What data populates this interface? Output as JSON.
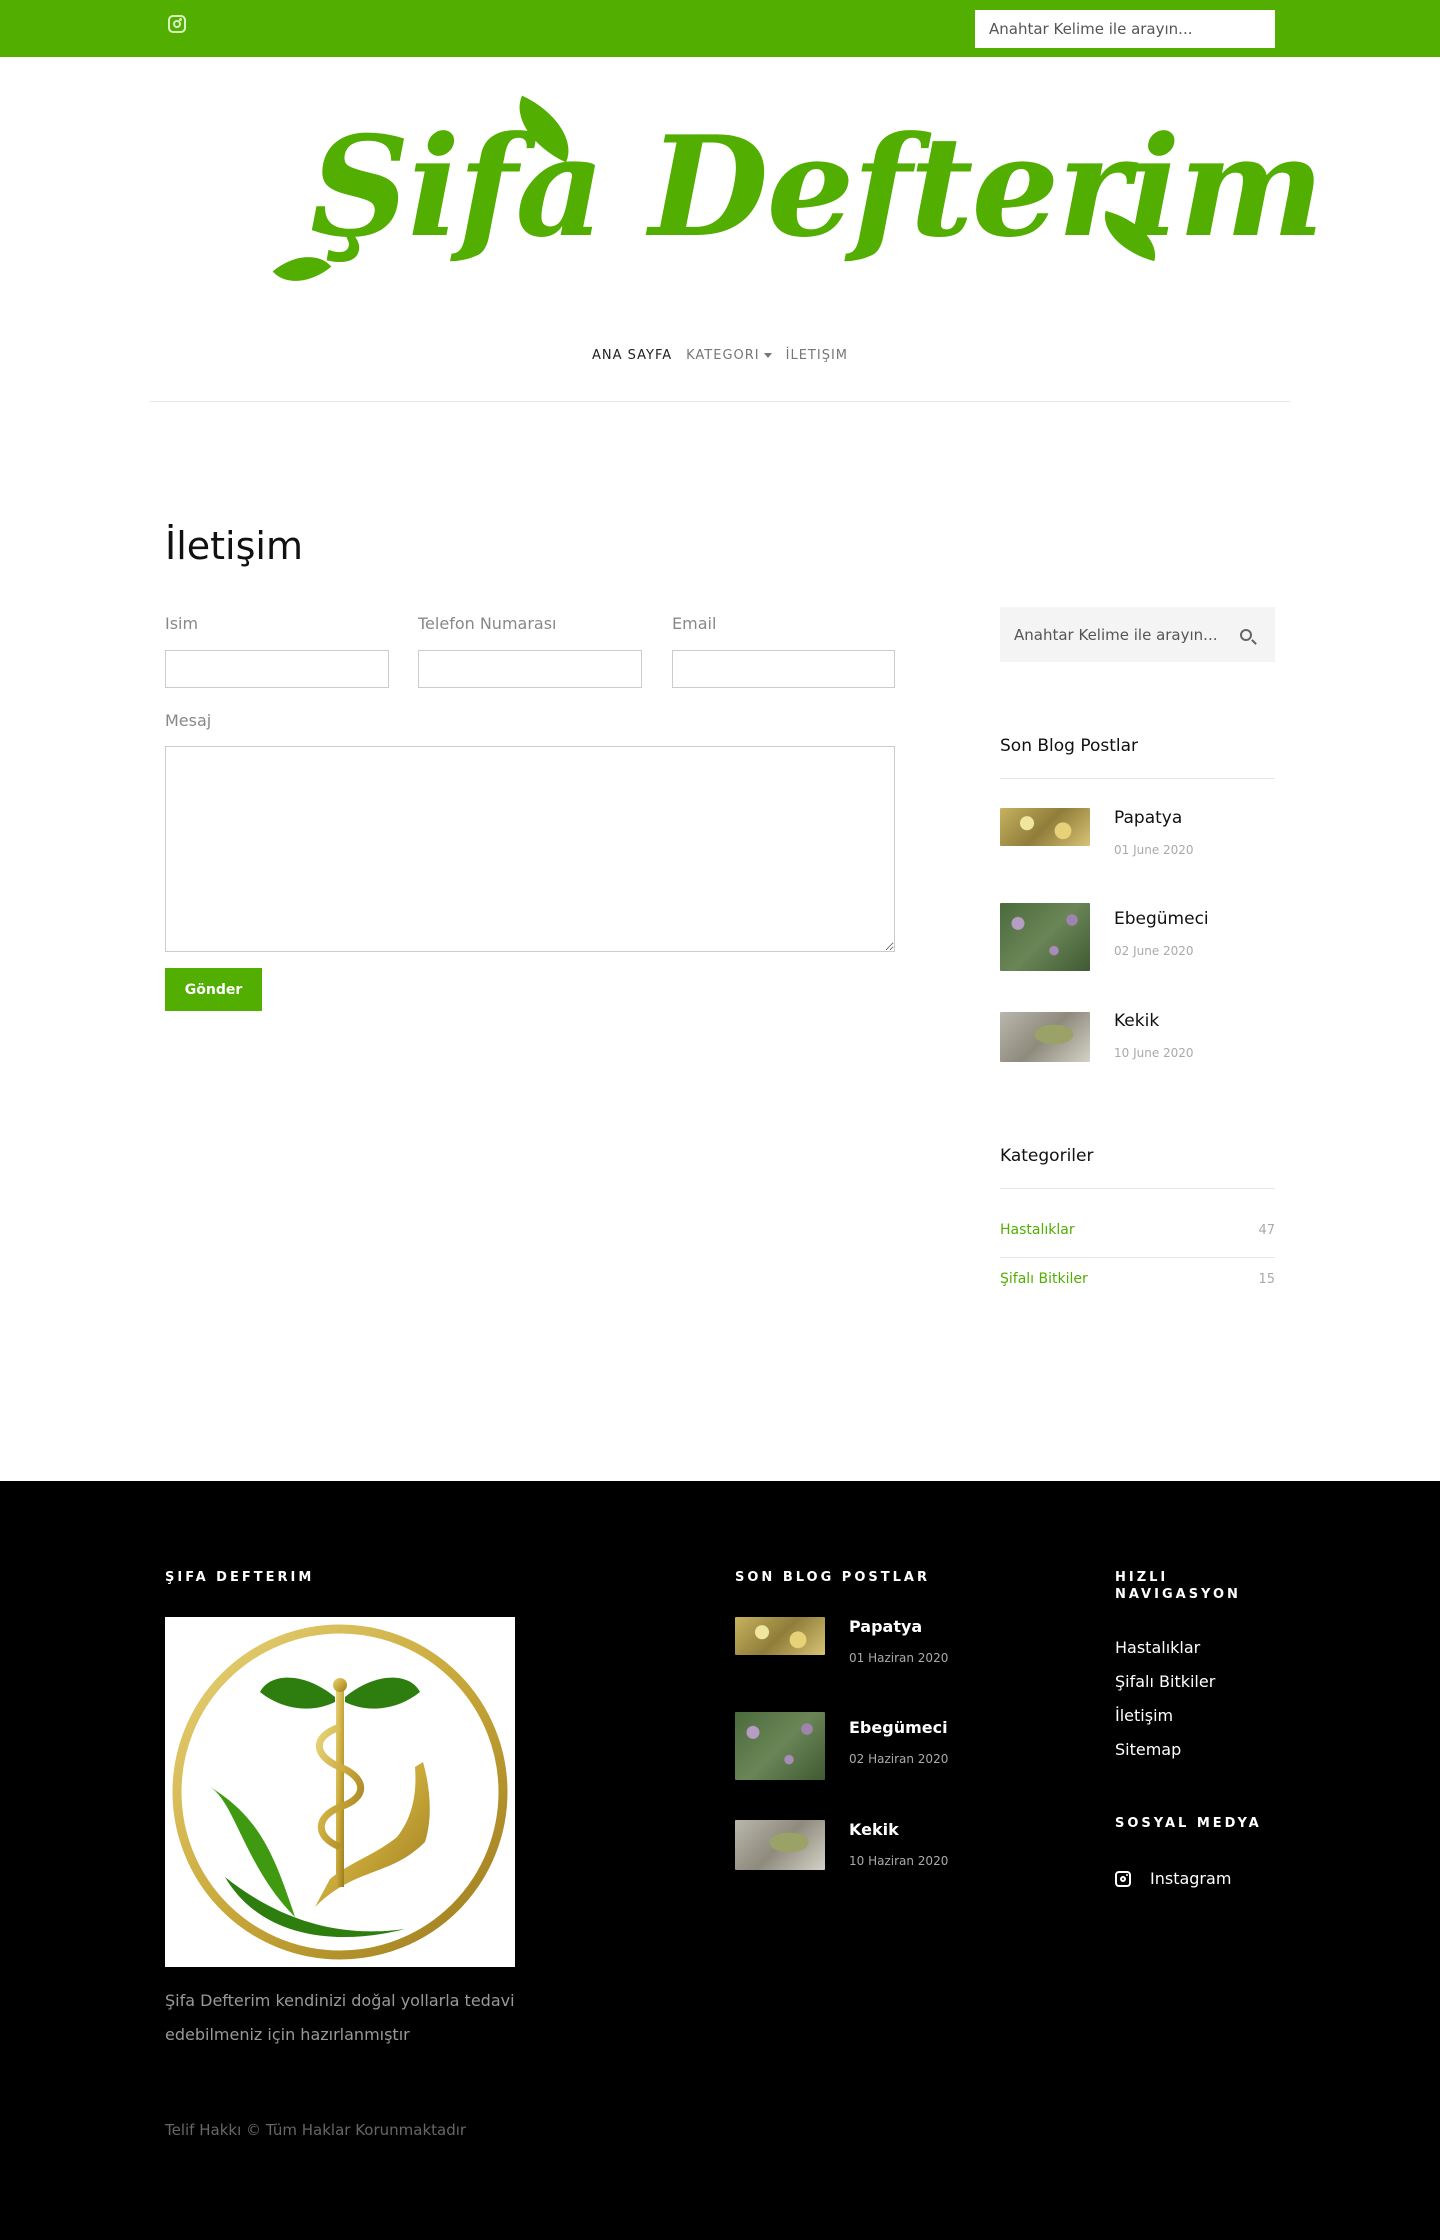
{
  "topbar": {
    "bg_color": "#52ae00",
    "instagram_icon": "instagram-icon",
    "search_placeholder": "Anahtar Kelime ile arayın..."
  },
  "logo": {
    "text": "Şifa Defterim",
    "color": "#52ae00"
  },
  "nav": {
    "items": [
      {
        "label": "ANA SAYFA",
        "active": true
      },
      {
        "label": "KATEGORI",
        "dropdown": true
      },
      {
        "label": "İLETIŞIM"
      }
    ]
  },
  "contact": {
    "title": "İletişim",
    "name_label": "Isim",
    "phone_label": "Telefon Numarası",
    "email_label": "Email",
    "message_label": "Mesaj",
    "submit_label": "Gönder"
  },
  "sidebar": {
    "search_placeholder": "Anahtar Kelime ile arayın...",
    "recent_heading": "Son Blog Postlar",
    "posts": [
      {
        "title": "Papatya",
        "date": "01 June 2020"
      },
      {
        "title": "Ebegümeci",
        "date": "02 June 2020"
      },
      {
        "title": "Kekik",
        "date": "10 June 2020"
      }
    ],
    "categories_heading": "Kategoriler",
    "categories": [
      {
        "name": "Hastalıklar",
        "count": "47"
      },
      {
        "name": "Şifalı Bitkiler",
        "count": "15"
      }
    ]
  },
  "footer": {
    "brand_heading": "ŞIFA DEFTERIM",
    "description": "Şifa Defterim kendinizi doğal yollarla tedavi edebilmeniz için hazırlanmıştır",
    "posts_heading": "SON BLOG POSTLAR",
    "posts": [
      {
        "title": "Papatya",
        "date": "01 Haziran 2020"
      },
      {
        "title": "Ebegümeci",
        "date": "02 Haziran 2020"
      },
      {
        "title": "Kekik",
        "date": "10 Haziran 2020"
      }
    ],
    "nav_heading_line1": "HIZLI",
    "nav_heading_line2": "NAVIGASYON",
    "nav_links": [
      "Hastalıklar",
      "Şifalı Bitkiler",
      "İletişim",
      "Sitemap"
    ],
    "social_heading": "SOSYAL MEDYA",
    "social_link": "Instagram",
    "copyright": "Telif Hakkı © Tüm Haklar Korunmaktadır"
  },
  "colors": {
    "accent": "#52ae00",
    "footer_bg": "#000000",
    "gold": "#c9a93a"
  }
}
